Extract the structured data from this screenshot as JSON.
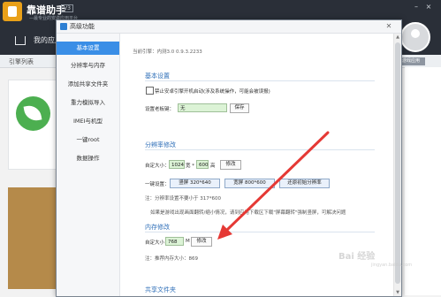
{
  "bg_app": {
    "title": "靠谱助手",
    "subtitle": "—最专业的安卓应用平台",
    "version": "V3",
    "home_label": "我的应用",
    "apps_list_label": "引擎列表",
    "right_button": "游戏应用"
  },
  "dialog": {
    "title": "高级功能",
    "close_label": "✕",
    "current_version": "当前引擎：内测3.0 0.9.3.2233"
  },
  "sidebar": {
    "items": [
      {
        "label": "基本设置",
        "active": true
      },
      {
        "label": "分辨率与内存",
        "active": false
      },
      {
        "label": "添加共享文件夹",
        "active": false
      },
      {
        "label": "重力模拟导入",
        "active": false
      },
      {
        "label": "IMEI与机型",
        "active": false
      },
      {
        "label": "一键root",
        "active": false
      },
      {
        "label": "数据操作",
        "active": false
      }
    ]
  },
  "basic": {
    "section_title": "基本设置",
    "checkbox_label": "禁止安卓引擎开机启动(涉及系统操作，可能会被误报)",
    "hotkey_label": "设置老板键：",
    "hotkey_value": "无",
    "save_button": "保存"
  },
  "resolution": {
    "section_title": "分辨率修改",
    "custom_label": "自定大小：",
    "width": "1024",
    "width_suffix": "宽 *",
    "height": "600",
    "height_suffix": "高",
    "modify_button": "修改",
    "one_key_label": "一键设置：",
    "preset_portrait": "竖屏 320*640",
    "preset_landscape": "宽屏 800*600",
    "preset_restore": "还原初始分辨率",
    "note1": "注：分辨率设置不要小于 317*600",
    "note2": "如果是游戏出现画面翻转/缩小情况，请到应用下载区下载\"屏幕翻转\"强制竖屏，可解决问题"
  },
  "memory": {
    "section_title": "内存修改",
    "custom_label": "自定大小",
    "value": "768",
    "unit": "M",
    "modify_button": "修改",
    "note": "注：推荐内存大小：869"
  },
  "shared": {
    "section_title": "共享文件夹"
  },
  "scrollbar": {
    "up": "▲",
    "down": "▼"
  },
  "watermark": {
    "text": "Bai 经验",
    "sub": "jingyan.baidu.com"
  },
  "colors": {
    "accent": "#3a8ee6",
    "section_title": "#2f6fb8",
    "input_bg": "#dcf3d6",
    "arrow": "#e53935"
  }
}
